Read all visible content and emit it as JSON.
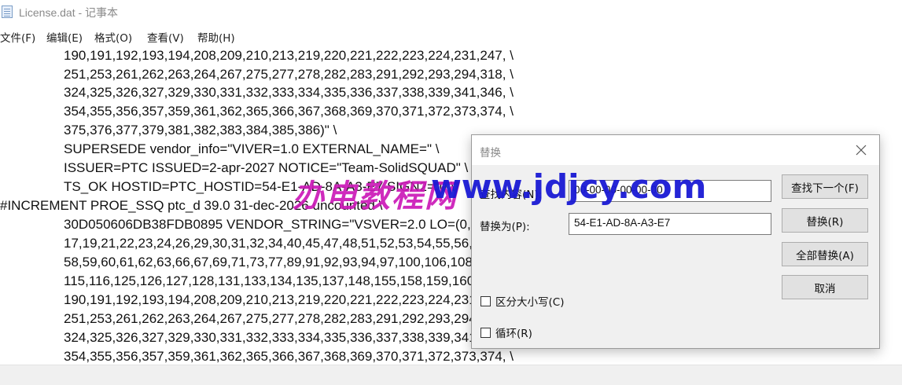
{
  "window": {
    "title": "License.dat - 记事本"
  },
  "menu": [
    {
      "label": "文件(F)"
    },
    {
      "label": "编辑(E)"
    },
    {
      "label": "格式(O)"
    },
    {
      "label": "查看(V)"
    },
    {
      "label": "帮助(H)"
    }
  ],
  "editor": {
    "lines": [
      "190,191,192,193,194,208,209,210,213,219,220,221,222,223,224,231,247, \\",
      "251,253,261,262,263,264,267,275,277,278,282,283,291,292,293,294,318, \\",
      "324,325,326,327,329,330,331,332,333,334,335,336,337,338,339,341,346, \\",
      "354,355,356,357,359,361,362,365,366,367,368,369,370,371,372,373,374, \\",
      "375,376,377,379,381,382,383,384,385,386)\" \\",
      "SUPERSEDE vendor_info=\"VIVER=1.0 EXTERNAL_NAME=\" \\",
      "ISSUER=PTC ISSUED=2-apr-2027 NOTICE=\"Team-SolidSQUAD\" \\",
      "TS_OK HOSTID=PTC_HOSTID=54-E1-AD-8A-A3-E7 SIGN2=\"0 \\",
      "#INCREMENT PROE_SSQ ptc_d 39.0 31-dec-2026 uncounted \\",
      "30D050606DB38FDB0895 VENDOR_STRING=\"VSVER=2.0 LO=(0,3,6,7,10,14, \\",
      "17,19,21,22,23,24,26,29,30,31,32,34,40,45,47,48,51,52,53,54,55,56, \\",
      "58,59,60,61,62,63,66,67,69,71,73,77,89,91,92,93,94,97,100,106,108, \\",
      "115,116,125,126,127,128,131,133,134,135,137,148,155,158,159,160, \\",
      "190,191,192,193,194,208,209,210,213,219,220,221,222,223,224,231,247, \\",
      "251,253,261,262,263,264,267,275,277,278,282,283,291,292,293,294,318, \\",
      "324,325,326,327,329,330,331,332,333,334,335,336,337,338,339,341,346, \\",
      "354,355,356,357,359,361,362,365,366,367,368,369,370,371,372,373,374, \\"
    ]
  },
  "dialog": {
    "title": "替换",
    "find_label": "查找内容(N):",
    "find_value": "00-00-00-00-00-00",
    "replace_label": "替换为(P):",
    "replace_value": "54-E1-AD-8A-A3-E7",
    "buttons": {
      "find_next": "查找下一个(F)",
      "replace": "替换(R)",
      "replace_all": "全部替换(A)",
      "cancel": "取消"
    },
    "options": {
      "match_case": "区分大小写(C)",
      "wrap_around": "循环(R)"
    }
  },
  "watermark": {
    "chinese": "办电教程网",
    "url": "www.jdjcy.com"
  }
}
